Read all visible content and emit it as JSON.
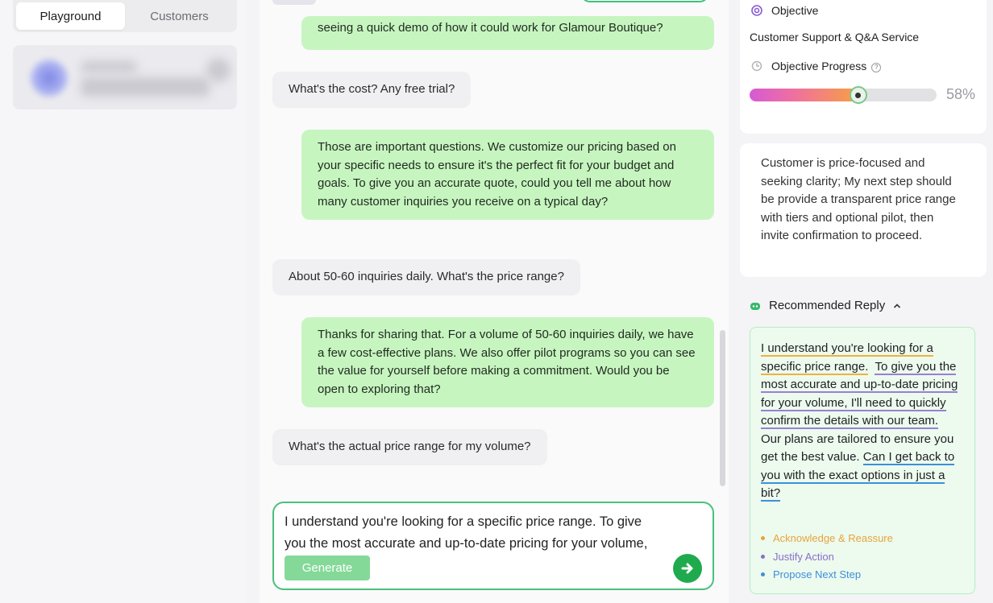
{
  "tabs": {
    "playground": "Playground",
    "customers": "Customers"
  },
  "chat": {
    "messages": [
      {
        "role": "ai",
        "text": "seeing a quick demo of how it could work for Glamour Boutique?"
      },
      {
        "role": "user",
        "text": "What's the cost? Any free trial?"
      },
      {
        "role": "ai",
        "text": "Those are important questions. We customize our pricing based on your specific needs to ensure it's the perfect fit for your budget and goals. To give you an accurate quote, could you tell me about how many customer inquiries you receive on a typical day?"
      },
      {
        "role": "user",
        "text": "About 50-60 inquiries daily. What's the price range?"
      },
      {
        "role": "ai",
        "text": "Thanks for sharing that. For a volume of 50-60 inquiries daily, we have a few cost-effective plans. We also offer pilot programs so you can see the value for yourself before making a commitment. Would you be open to exploring that?"
      },
      {
        "role": "user",
        "text": "What's the actual price range for my volume?"
      }
    ],
    "composer": {
      "line1": "I understand you're looking for a specific price range. To give",
      "line2": "you the most accurate and up-to-date pricing for your volume,",
      "generate_label": "Generate"
    }
  },
  "objective": {
    "label": "Objective",
    "value": "Customer Support & Q&A Service",
    "progress_label": "Objective Progress",
    "help_glyph": "?",
    "progress_value": 58,
    "progress_text": "58%"
  },
  "insight": "Customer is price-focused and seeking clarity; My next step should be provide a transparent price range with tiers and optional pilot, then invite confirmation to proceed.",
  "recommended": {
    "title": "Recommended Reply",
    "seg1": "I understand you're looking for a specific price range.",
    "seg2": "To give you the most accurate and up-to-date pricing for your volume, I'll need to quickly confirm the details with our team.",
    "seg3": "Our plans are tailored to ensure you get the best value.",
    "seg4": "Can I get back to you with the exact options in just a bit?",
    "legend": [
      {
        "label": "Acknowledge & Reassure",
        "color": "#e8a33a"
      },
      {
        "label": "Justify Action",
        "color": "#8a6ccb"
      },
      {
        "label": "Propose Next Step",
        "color": "#3f8edc"
      }
    ]
  },
  "colors": {
    "ai_bubble": "#c7f5c0",
    "user_bubble": "#f0f0f3",
    "accent_green": "#1faa4e"
  }
}
